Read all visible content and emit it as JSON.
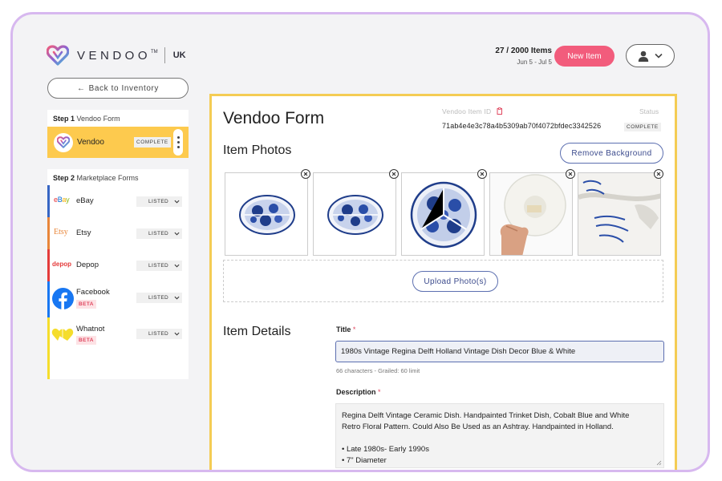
{
  "header": {
    "brand": "VENDOO",
    "tm": "TM",
    "region": "UK",
    "items_count": "27 / 2000 Items",
    "date_range": "Jun 5 - Jul 5",
    "new_item_label": "New Item",
    "back_label": "Back to Inventory"
  },
  "sidebar": {
    "step1_prefix": "Step 1",
    "step1_text": "Vendoo Form",
    "vendoo_label": "Vendoo",
    "vendoo_status": "COMPLETE",
    "step2_prefix": "Step 2",
    "step2_text": "Marketplace Forms",
    "marketplaces": [
      {
        "name": "eBay",
        "logo": "eBay",
        "status": "LISTED",
        "bar_color": "#3665c3"
      },
      {
        "name": "Etsy",
        "logo": "Etsy",
        "status": "LISTED",
        "bar_color": "#e8863a"
      },
      {
        "name": "Depop",
        "logo": "depop",
        "status": "LISTED",
        "bar_color": "#e43b3b"
      },
      {
        "name": "Facebook",
        "status": "LISTED",
        "badge": "BETA",
        "bar_color": "#1877f2"
      },
      {
        "name": "Whatnot",
        "status": "LISTED",
        "badge": "BETA",
        "bar_color": "#f5dd2c"
      }
    ]
  },
  "form": {
    "title": "Vendoo Form",
    "item_id_label": "Vendoo Item ID",
    "item_id": "71ab4e4e3c78a4b5309ab70f4072bfdec3342526",
    "status_label": "Status",
    "status": "COMPLETE",
    "photos_heading": "Item Photos",
    "remove_bg_label": "Remove Background",
    "upload_label": "Upload Photo(s)",
    "details_heading": "Item Details",
    "title_label": "Title",
    "title_value": "1980s Vintage Regina Delft Holland Vintage Dish Decor Blue & White",
    "title_hint": "66 characters - Grailed: 60 limit",
    "description_label": "Description",
    "description_lines": [
      "Regina Delft Vintage Ceramic Dish. Handpainted Trinket Dish, Cobalt Blue and White",
      "Retro Floral Pattern. Could Also Be Used as an Ashtray. Handpainted in Holland.",
      "",
      "• Late 1980s- Early 1990s",
      "• 7\" Diameter"
    ],
    "required_mark": "*"
  },
  "colors": {
    "accent_pink": "#f25c7c",
    "vendoo_yellow": "#fdca4e",
    "link_blue": "#3b4a8c",
    "frame_purple": "#d7b8ef"
  }
}
